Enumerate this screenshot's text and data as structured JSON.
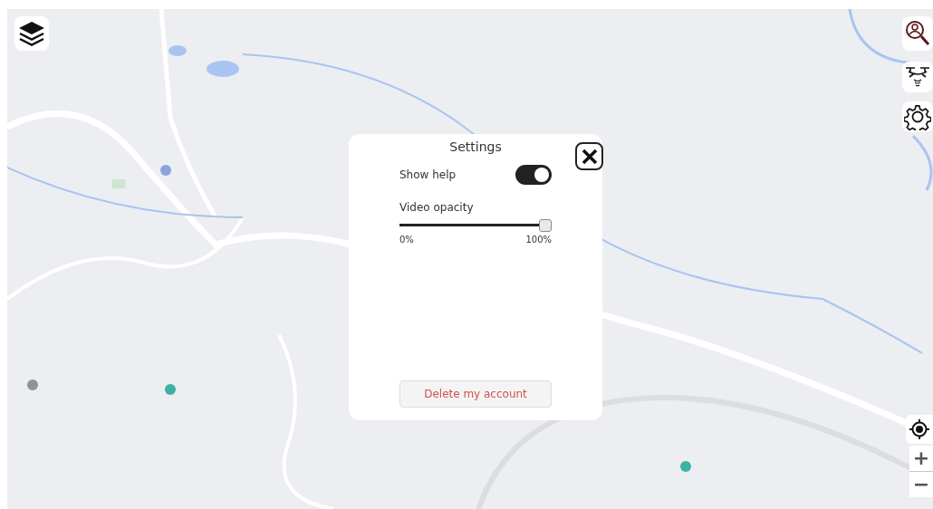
{
  "settings": {
    "title": "Settings",
    "show_help": {
      "label": "Show help",
      "on": true
    },
    "video_opacity": {
      "label": "Video opacity",
      "level": 1,
      "min_label": "0%",
      "max_label": "100%"
    },
    "delete_button": "Delete my account"
  },
  "zoom_controls": {
    "zoom_in": "+",
    "zoom_out": "−"
  }
}
